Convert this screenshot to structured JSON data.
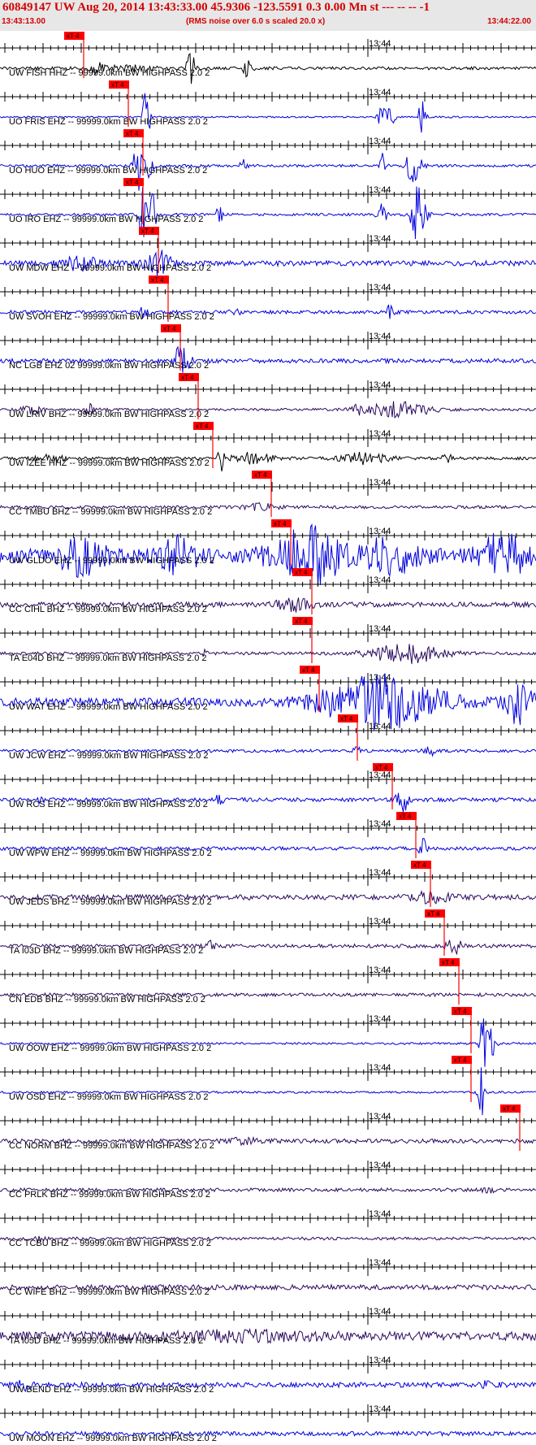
{
  "header": {
    "title": "60849147 UW Aug 20, 2014 13:43:33.00   45.9306 -123.5591  0.3 0.00 Mn st --- -- --  -1",
    "start_time": "13:43:13.00",
    "rms_note": "(RMS noise over 6.0 s scaled 20.0 x)",
    "end_time": "13:44:22.00"
  },
  "chart_data": {
    "type": "line",
    "title": "60849147 UW Aug 20, 2014 13:43:33.00   45.9306 -123.5591  0.3 0.00 Mn st --- -- --  -1",
    "time_range": [
      "13:43:13.00",
      "13:44:22.00"
    ],
    "time_tick_label": "13:44",
    "pick_label": "xT 4",
    "grid": false,
    "colors": {
      "black": "#000000",
      "blue": "#0000dd",
      "dark": "#2a0a5e",
      "pick": "#ff0000"
    },
    "traces": [
      {
        "label": "UW FISH HHZ -- 99999.0km BW  HIGHPASS  2.0  2",
        "color": "black",
        "pick": 103,
        "noise": 0.07,
        "bursts": [
          [
            120,
            8,
            0.25
          ],
          [
            235,
            5,
            0.85
          ],
          [
            305,
            5,
            0.6
          ],
          [
            160,
            30,
            0.12
          ]
        ]
      },
      {
        "label": "UO FRIS EHZ -- 99999.0km BW  HIGHPASS  2.0  2",
        "color": "blue",
        "pick": 158,
        "noise": 0.04,
        "bursts": [
          [
            178,
            3,
            1.1
          ],
          [
            183,
            3,
            0.8
          ],
          [
            470,
            4,
            0.9
          ],
          [
            520,
            4,
            1.1
          ],
          [
            480,
            6,
            0.5
          ]
        ]
      },
      {
        "label": "UO HUO EHZ -- 99999.0km BW  HIGHPASS  2.0  2",
        "color": "blue",
        "pick": 176,
        "noise": 0.06,
        "bursts": [
          [
            170,
            5,
            1.4
          ],
          [
            184,
            4,
            1.2
          ],
          [
            510,
            8,
            1.3
          ],
          [
            470,
            5,
            0.6
          ],
          [
            300,
            5,
            0.3
          ]
        ]
      },
      {
        "label": "UO IRO EHZ -- 99999.0km BW  HIGHPASS  2.0  2",
        "color": "blue",
        "pick": 176,
        "noise": 0.06,
        "bursts": [
          [
            175,
            5,
            1.4
          ],
          [
            188,
            4,
            1.1
          ],
          [
            270,
            3,
            0.8
          ],
          [
            515,
            9,
            1.4
          ],
          [
            470,
            5,
            0.8
          ]
        ]
      },
      {
        "label": "UW MDW EHZ -- 99999.0km BW  HIGHPASS  2.0  2",
        "color": "blue",
        "pick": 195,
        "noise": 0.12,
        "bursts": [
          [
            100,
            25,
            0.3
          ],
          [
            190,
            12,
            0.6
          ],
          [
            205,
            8,
            0.45
          ]
        ]
      },
      {
        "label": "UW SVOH EHZ -- 99999.0km BW  HIGHPASS  2.0  2",
        "color": "blue",
        "pick": 207,
        "noise": 0.08,
        "bursts": [
          [
            178,
            5,
            0.35
          ],
          [
            290,
            6,
            0.2
          ],
          [
            480,
            5,
            0.3
          ]
        ]
      },
      {
        "label": "NC LGB EHZ 02 99999.0km BW  HIGHPASS  2.0  2",
        "color": "blue",
        "pick": 222,
        "noise": 0.1,
        "bursts": [
          [
            220,
            8,
            0.55
          ],
          [
            230,
            6,
            0.4
          ]
        ]
      },
      {
        "label": "UW LRIV BHZ -- 99999.0km BW  HIGHPASS  2.0  2",
        "color": "dark",
        "pick": 244,
        "noise": 0.06,
        "bursts": [
          [
            490,
            40,
            0.35
          ],
          [
            40,
            15,
            0.2
          ],
          [
            110,
            8,
            0.25
          ],
          [
            440,
            5,
            0.2
          ]
        ]
      },
      {
        "label": "UW IZEE HHZ -- 99999.0km BW  HIGHPASS  2.0  2",
        "color": "black",
        "pick": 262,
        "noise": 0.07,
        "bursts": [
          [
            272,
            3,
            0.85
          ],
          [
            310,
            25,
            0.25
          ],
          [
            450,
            30,
            0.25
          ],
          [
            550,
            5,
            0.3
          ],
          [
            60,
            20,
            0.15
          ]
        ]
      },
      {
        "label": "CC TMBU BHZ -- 99999.0km BW  HIGHPASS  2.0  2",
        "color": "dark",
        "pick": 334,
        "noise": 0.07,
        "bursts": [
          [
            320,
            20,
            0.15
          ]
        ]
      },
      {
        "label": "UW GLDO EHZ -- 99999.0km BW  HIGHPASS  2.0  2",
        "color": "blue",
        "pick": 358,
        "noise": 0.35,
        "bursts": [
          [
            100,
            25,
            0.8
          ],
          [
            220,
            20,
            0.7
          ],
          [
            380,
            40,
            1.2
          ],
          [
            480,
            30,
            0.8
          ],
          [
            620,
            25,
            1.0
          ]
        ]
      },
      {
        "label": "CC CIHL BHZ -- 99999.0km BW  HIGHPASS  2.0  2",
        "color": "dark",
        "pick": 384,
        "noise": 0.12,
        "bursts": [
          [
            360,
            20,
            0.3
          ]
        ]
      },
      {
        "label": "TA E04D BHZ -- 99999.0km BW  HIGHPASS  2.0  2",
        "color": "dark",
        "pick": 384,
        "noise": 0.07,
        "bursts": [
          [
            500,
            45,
            0.45
          ],
          [
            250,
            5,
            0.15
          ]
        ]
      },
      {
        "label": "UW WAT EHZ -- 99999.0km BW  HIGHPASS  2.0  2",
        "color": "blue",
        "pick": 393,
        "noise": 0.2,
        "bursts": [
          [
            470,
            70,
            1.2
          ],
          [
            640,
            15,
            1.1
          ]
        ]
      },
      {
        "label": "UW JCW EHZ -- 99999.0km BW  HIGHPASS  2.0  2",
        "color": "blue",
        "pick": 440,
        "noise": 0.07,
        "bursts": [
          [
            440,
            5,
            0.35
          ],
          [
            530,
            8,
            0.2
          ]
        ]
      },
      {
        "label": "UW RCS EHZ -- 99999.0km BW  HIGHPASS  2.0  2",
        "color": "blue",
        "pick": 483,
        "noise": 0.09,
        "bursts": [
          [
            495,
            8,
            0.6
          ],
          [
            270,
            4,
            0.3
          ],
          [
            50,
            5,
            0.15
          ]
        ]
      },
      {
        "label": "UW WPW EHZ -- 99999.0km BW  HIGHPASS  2.0  2",
        "color": "blue",
        "pick": 512,
        "noise": 0.08,
        "bursts": [
          [
            520,
            5,
            0.5
          ]
        ]
      },
      {
        "label": "UW JEDS BHZ -- 99999.0km BW  HIGHPASS  2.0  2",
        "color": "dark",
        "pick": 530,
        "noise": 0.12,
        "bursts": [
          [
            530,
            25,
            0.2
          ]
        ]
      },
      {
        "label": "TA I03D BHZ -- 99999.0km BW  HIGHPASS  2.0  2",
        "color": "dark",
        "pick": 547,
        "noise": 0.09,
        "bursts": [
          [
            560,
            10,
            0.3
          ],
          [
            260,
            4,
            0.3
          ]
        ]
      },
      {
        "label": "CN EDB BHZ -- 99999.0km BW  HIGHPASS  2.0  2",
        "color": "dark",
        "pick": 565,
        "noise": 0.08,
        "bursts": []
      },
      {
        "label": "UW OOW EHZ -- 99999.0km BW  HIGHPASS  2.0  2",
        "color": "blue",
        "pick": 580,
        "noise": 0.05,
        "bursts": [
          [
            595,
            4,
            1.5
          ],
          [
            605,
            5,
            1.0
          ]
        ]
      },
      {
        "label": "UW OSD EHZ -- 99999.0km BW  HIGHPASS  2.0  2",
        "color": "blue",
        "pick": 580,
        "noise": 0.05,
        "bursts": [
          [
            593,
            4,
            1.5
          ]
        ]
      },
      {
        "label": "CC NORM BHZ -- 99999.0km BW  HIGHPASS  2.0  2",
        "color": "dark",
        "pick": 640,
        "noise": 0.1,
        "bursts": [
          [
            300,
            20,
            0.1
          ]
        ]
      },
      {
        "label": "CC PRLK BHZ -- 99999.0km BW  HIGHPASS  2.0  2",
        "color": "dark",
        "pick": null,
        "noise": 0.08,
        "bursts": [
          [
            600,
            8,
            0.15
          ]
        ]
      },
      {
        "label": "CC TCBU BHZ -- 99999.0km BW  HIGHPASS  2.0  2",
        "color": "dark",
        "pick": null,
        "noise": 0.07,
        "bursts": [
          [
            50,
            5,
            0.15
          ]
        ]
      },
      {
        "label": "CC WIFE BHZ -- 99999.0km BW  HIGHPASS  2.0  2",
        "color": "dark",
        "pick": null,
        "noise": 0.12,
        "bursts": []
      },
      {
        "label": "TA I05D BHZ -- 99999.0km BW  HIGHPASS  2.0  2",
        "color": "dark",
        "pick": null,
        "noise": 0.2,
        "bursts": [
          [
            300,
            100,
            0.15
          ]
        ]
      },
      {
        "label": "UW BEND EHZ -- 99999.0km BW  HIGHPASS  2.0  2",
        "color": "blue",
        "pick": null,
        "noise": 0.12,
        "bursts": [
          [
            30,
            10,
            0.2
          ],
          [
            600,
            10,
            0.15
          ]
        ]
      },
      {
        "label": "UW MOON EHZ -- 99999.0km BW  HIGHPASS  2.0  2",
        "color": "blue",
        "pick": null,
        "noise": 0.1,
        "bursts": []
      }
    ]
  }
}
